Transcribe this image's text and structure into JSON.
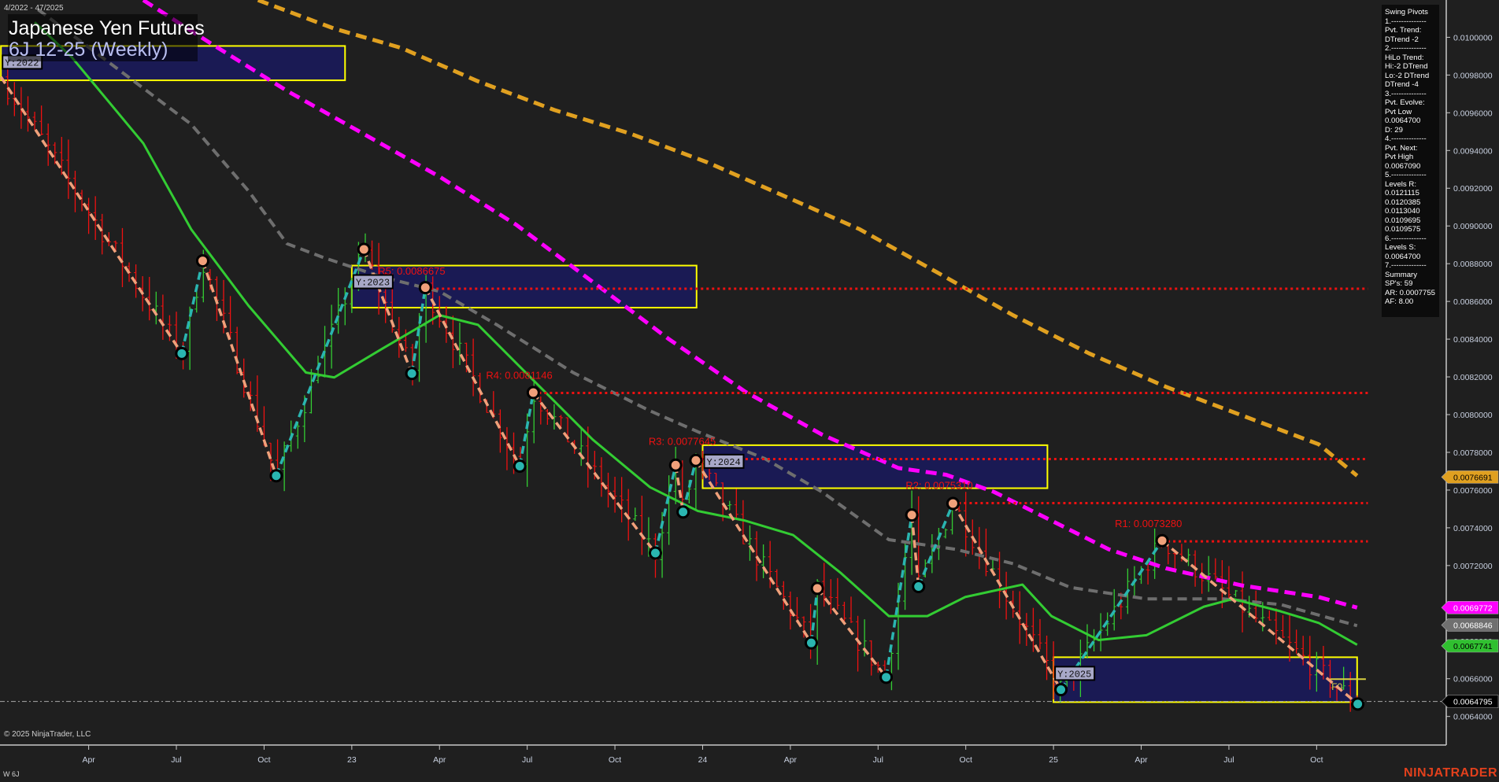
{
  "header": {
    "date_range": "4/2022 - 47/2025",
    "title": "Japanese Yen Futures",
    "subtitle": "6J 12-25 (Weekly)"
  },
  "footer": {
    "copyright": "© 2025 NinjaTrader, LLC",
    "instrument": "W 6J",
    "brand": "NINJATRADER"
  },
  "info_panel": {
    "lines": [
      "Swing Pivots",
      "1.--------------",
      "Pvt. Trend:",
      "DTrend -2",
      "2.--------------",
      "HiLo Trend:",
      "Hi:-2 DTrend",
      "Lo:-2 DTrend",
      "DTrend -4",
      "3.--------------",
      "Pvt. Evolve:",
      "Pvt Low",
      "0.0064700",
      "D: 29",
      "4.--------------",
      "Pvt. Next:",
      "Pvt High",
      "0.0067090",
      "5.--------------",
      "Levels R:",
      "0.0121115",
      "0.0120385",
      "0.0113040",
      "0.0109695",
      "0.0109575",
      "6.--------------",
      "Levels S:",
      "0.0064700",
      "7.--------------",
      "Summary",
      "SP's: 59",
      "AR: 0.0007755",
      "AF: 8.00"
    ]
  },
  "chart_data": {
    "type": "line",
    "title": "Japanese Yen Futures 6J 12-25 (Weekly)",
    "x_unit": "weeks since Jan 2022",
    "xlim": [
      0,
      203
    ],
    "ylim": [
      0.0062,
      0.0102
    ],
    "x_ticks": [
      {
        "w": 13,
        "label": "Apr"
      },
      {
        "w": 26,
        "label": "Jul"
      },
      {
        "w": 39,
        "label": "Oct"
      },
      {
        "w": 52,
        "label": "23"
      },
      {
        "w": 65,
        "label": "Apr"
      },
      {
        "w": 78,
        "label": "Jul"
      },
      {
        "w": 91,
        "label": "Oct"
      },
      {
        "w": 104,
        "label": "24"
      },
      {
        "w": 117,
        "label": "Apr"
      },
      {
        "w": 130,
        "label": "Jul"
      },
      {
        "w": 143,
        "label": "Oct"
      },
      {
        "w": 156,
        "label": "25"
      },
      {
        "w": 169,
        "label": "Apr"
      },
      {
        "w": 182,
        "label": "Jul"
      },
      {
        "w": 195,
        "label": "Oct"
      }
    ],
    "y_ticks": [
      "0.0064000",
      "0.0066000",
      "0.0068000",
      "0.0070000",
      "0.0072000",
      "0.0074000",
      "0.0076000",
      "0.0078000",
      "0.0080000",
      "0.0082000",
      "0.0084000",
      "0.0086000",
      "0.0088000",
      "0.0090000",
      "0.0092000",
      "0.0094000",
      "0.0096000",
      "0.0098000",
      "0.0100000"
    ],
    "price_tags": [
      {
        "value": "0.0076691",
        "color": "#e0a020",
        "text": "#000000"
      },
      {
        "value": "0.0069772",
        "color": "#ff00ff",
        "text": "#ffffff"
      },
      {
        "value": "0.0068846",
        "color": "#707070",
        "text": "#ffffff"
      },
      {
        "value": "0.0067741",
        "color": "#30c030",
        "text": "#000000"
      },
      {
        "value": "0.0064795",
        "color": "#000000",
        "text": "#ffffff"
      }
    ],
    "last_price": 0.0064795,
    "pivots": [
      [
        0,
        0.00979,
        "H"
      ],
      [
        26.8,
        0.008324,
        "L"
      ],
      [
        29.9,
        0.008815,
        "H"
      ],
      [
        40.8,
        0.007676,
        "L"
      ],
      [
        53.8,
        0.008876,
        "H"
      ],
      [
        60.9,
        0.008218,
        "L"
      ],
      [
        62.9,
        0.008673,
        "H"
      ],
      [
        76.9,
        0.007727,
        "L"
      ],
      [
        78.9,
        0.008117,
        "H"
      ],
      [
        97,
        0.007266,
        "L"
      ],
      [
        100,
        0.007732,
        "H"
      ],
      [
        101.1,
        0.007484,
        "L"
      ],
      [
        103,
        0.007757,
        "H"
      ],
      [
        120.1,
        0.00679,
        "L"
      ],
      [
        121,
        0.007079,
        "H"
      ],
      [
        131.2,
        0.006608,
        "L"
      ],
      [
        135,
        0.007468,
        "H"
      ],
      [
        136,
        0.007089,
        "L"
      ],
      [
        141.1,
        0.007529,
        "H"
      ],
      [
        157.1,
        0.006542,
        "L"
      ],
      [
        172.1,
        0.007332,
        "H"
      ],
      [
        201.1,
        0.006466,
        "L"
      ]
    ],
    "resistance": [
      {
        "label": "R5: 0.0086675",
        "value": 0.0086675,
        "from": 62.9
      },
      {
        "label": "R4: 0.0081146",
        "value": 0.0081146,
        "from": 78.9
      },
      {
        "label": "R3: 0.0077645",
        "value": 0.0077645,
        "from": 103
      },
      {
        "label": "R2: 0.0075310",
        "value": 0.007531,
        "from": 141.1
      },
      {
        "label": "R1: 0.0073280",
        "value": 0.007328,
        "from": 172.1
      }
    ],
    "year_boxes": [
      {
        "label": "Y:2022",
        "w0": 0,
        "w1": 51,
        "hi": 0.009954,
        "lo": 0.009772
      },
      {
        "label": "Y:2023",
        "w0": 52,
        "w1": 103.1,
        "hi": 0.00879,
        "lo": 0.008567
      },
      {
        "label": "Y:2024",
        "w0": 104,
        "w1": 155.1,
        "hi": 0.007838,
        "lo": 0.00761
      },
      {
        "label": "Y:2025",
        "w0": 156,
        "w1": 201,
        "hi": 0.006714,
        "lo": 0.006476
      }
    ],
    "f0": {
      "label": "F0",
      "value": 0.006598
    },
    "series": [
      {
        "name": "ma-orange",
        "color": "#e0a020",
        "width": 5,
        "dash": "14 8",
        "points": [
          [
            38.1,
            0.010197
          ],
          [
            49.4,
            0.010046
          ],
          [
            59.3,
            0.009944
          ],
          [
            70.7,
            0.009767
          ],
          [
            82,
            0.009615
          ],
          [
            93.3,
            0.009489
          ],
          [
            104.7,
            0.009337
          ],
          [
            116,
            0.00916
          ],
          [
            127.3,
            0.008982
          ],
          [
            138.7,
            0.008755
          ],
          [
            150,
            0.008527
          ],
          [
            161.3,
            0.008324
          ],
          [
            172.7,
            0.008147
          ],
          [
            184,
            0.007995
          ],
          [
            195.3,
            0.007843
          ],
          [
            201,
            0.007676
          ]
        ]
      },
      {
        "name": "ma-magenta",
        "color": "#ff00ff",
        "width": 5,
        "dash": "14 8",
        "points": [
          [
            21.1,
            0.010197
          ],
          [
            31,
            0.00997
          ],
          [
            42.4,
            0.009716
          ],
          [
            53.7,
            0.009489
          ],
          [
            65,
            0.009261
          ],
          [
            76.3,
            0.009008
          ],
          [
            87.7,
            0.008704
          ],
          [
            99,
            0.0084
          ],
          [
            110.3,
            0.008122
          ],
          [
            121.7,
            0.007894
          ],
          [
            133,
            0.007717
          ],
          [
            140.1,
            0.007681
          ],
          [
            147.2,
            0.00759
          ],
          [
            155.7,
            0.007438
          ],
          [
            164.2,
            0.007286
          ],
          [
            172.7,
            0.007185
          ],
          [
            184,
            0.007094
          ],
          [
            195.3,
            0.007033
          ],
          [
            201,
            0.006977
          ]
        ]
      },
      {
        "name": "ma-gray",
        "color": "#6e6e6e",
        "width": 4,
        "dash": "12 7",
        "points": [
          [
            5.5,
            0.010147
          ],
          [
            16.9,
            0.009843
          ],
          [
            28.2,
            0.009539
          ],
          [
            36.7,
            0.009185
          ],
          [
            42.4,
            0.008906
          ],
          [
            48,
            0.00883
          ],
          [
            56.5,
            0.008729
          ],
          [
            65,
            0.008653
          ],
          [
            73.5,
            0.008476
          ],
          [
            84.8,
            0.008223
          ],
          [
            96.2,
            0.00802
          ],
          [
            103.3,
            0.007909
          ],
          [
            113.2,
            0.007767
          ],
          [
            121.7,
            0.00759
          ],
          [
            131.6,
            0.007337
          ],
          [
            141.5,
            0.007286
          ],
          [
            150,
            0.00721
          ],
          [
            158.5,
            0.007084
          ],
          [
            169.8,
            0.007023
          ],
          [
            181.2,
            0.007023
          ],
          [
            189.7,
            0.006993
          ],
          [
            201,
            0.006881
          ]
        ]
      },
      {
        "name": "ma-green",
        "color": "#33cc33",
        "width": 3,
        "dash": "",
        "points": [
          [
            5,
            0.01008
          ],
          [
            10.5,
            0.009894
          ],
          [
            21.1,
            0.009438
          ],
          [
            28.2,
            0.008982
          ],
          [
            36.7,
            0.008577
          ],
          [
            45.2,
            0.008223
          ],
          [
            49.4,
            0.008197
          ],
          [
            56.5,
            0.008349
          ],
          [
            65,
            0.008527
          ],
          [
            70.7,
            0.008476
          ],
          [
            79.2,
            0.008172
          ],
          [
            87.7,
            0.007868
          ],
          [
            96.2,
            0.007615
          ],
          [
            103.3,
            0.007489
          ],
          [
            110.3,
            0.007438
          ],
          [
            117.4,
            0.007362
          ],
          [
            124.5,
            0.00716
          ],
          [
            131.6,
            0.006932
          ],
          [
            137.3,
            0.006932
          ],
          [
            142.9,
            0.007033
          ],
          [
            151.4,
            0.007099
          ],
          [
            155.7,
            0.006932
          ],
          [
            162.7,
            0.006805
          ],
          [
            169.8,
            0.006831
          ],
          [
            178.3,
            0.006982
          ],
          [
            182.6,
            0.007023
          ],
          [
            189.7,
            0.006957
          ],
          [
            195.3,
            0.006896
          ],
          [
            201,
            0.00678
          ]
        ]
      }
    ],
    "colors": {
      "up_swing": "#2ab5b0",
      "down_swing": "#f0a07a",
      "resistance": "#ee1111",
      "box_fill": "#1a1a5a",
      "box_border": "#ffff00",
      "up_bar": "#33cc33",
      "down_bar": "#ee1111"
    }
  }
}
